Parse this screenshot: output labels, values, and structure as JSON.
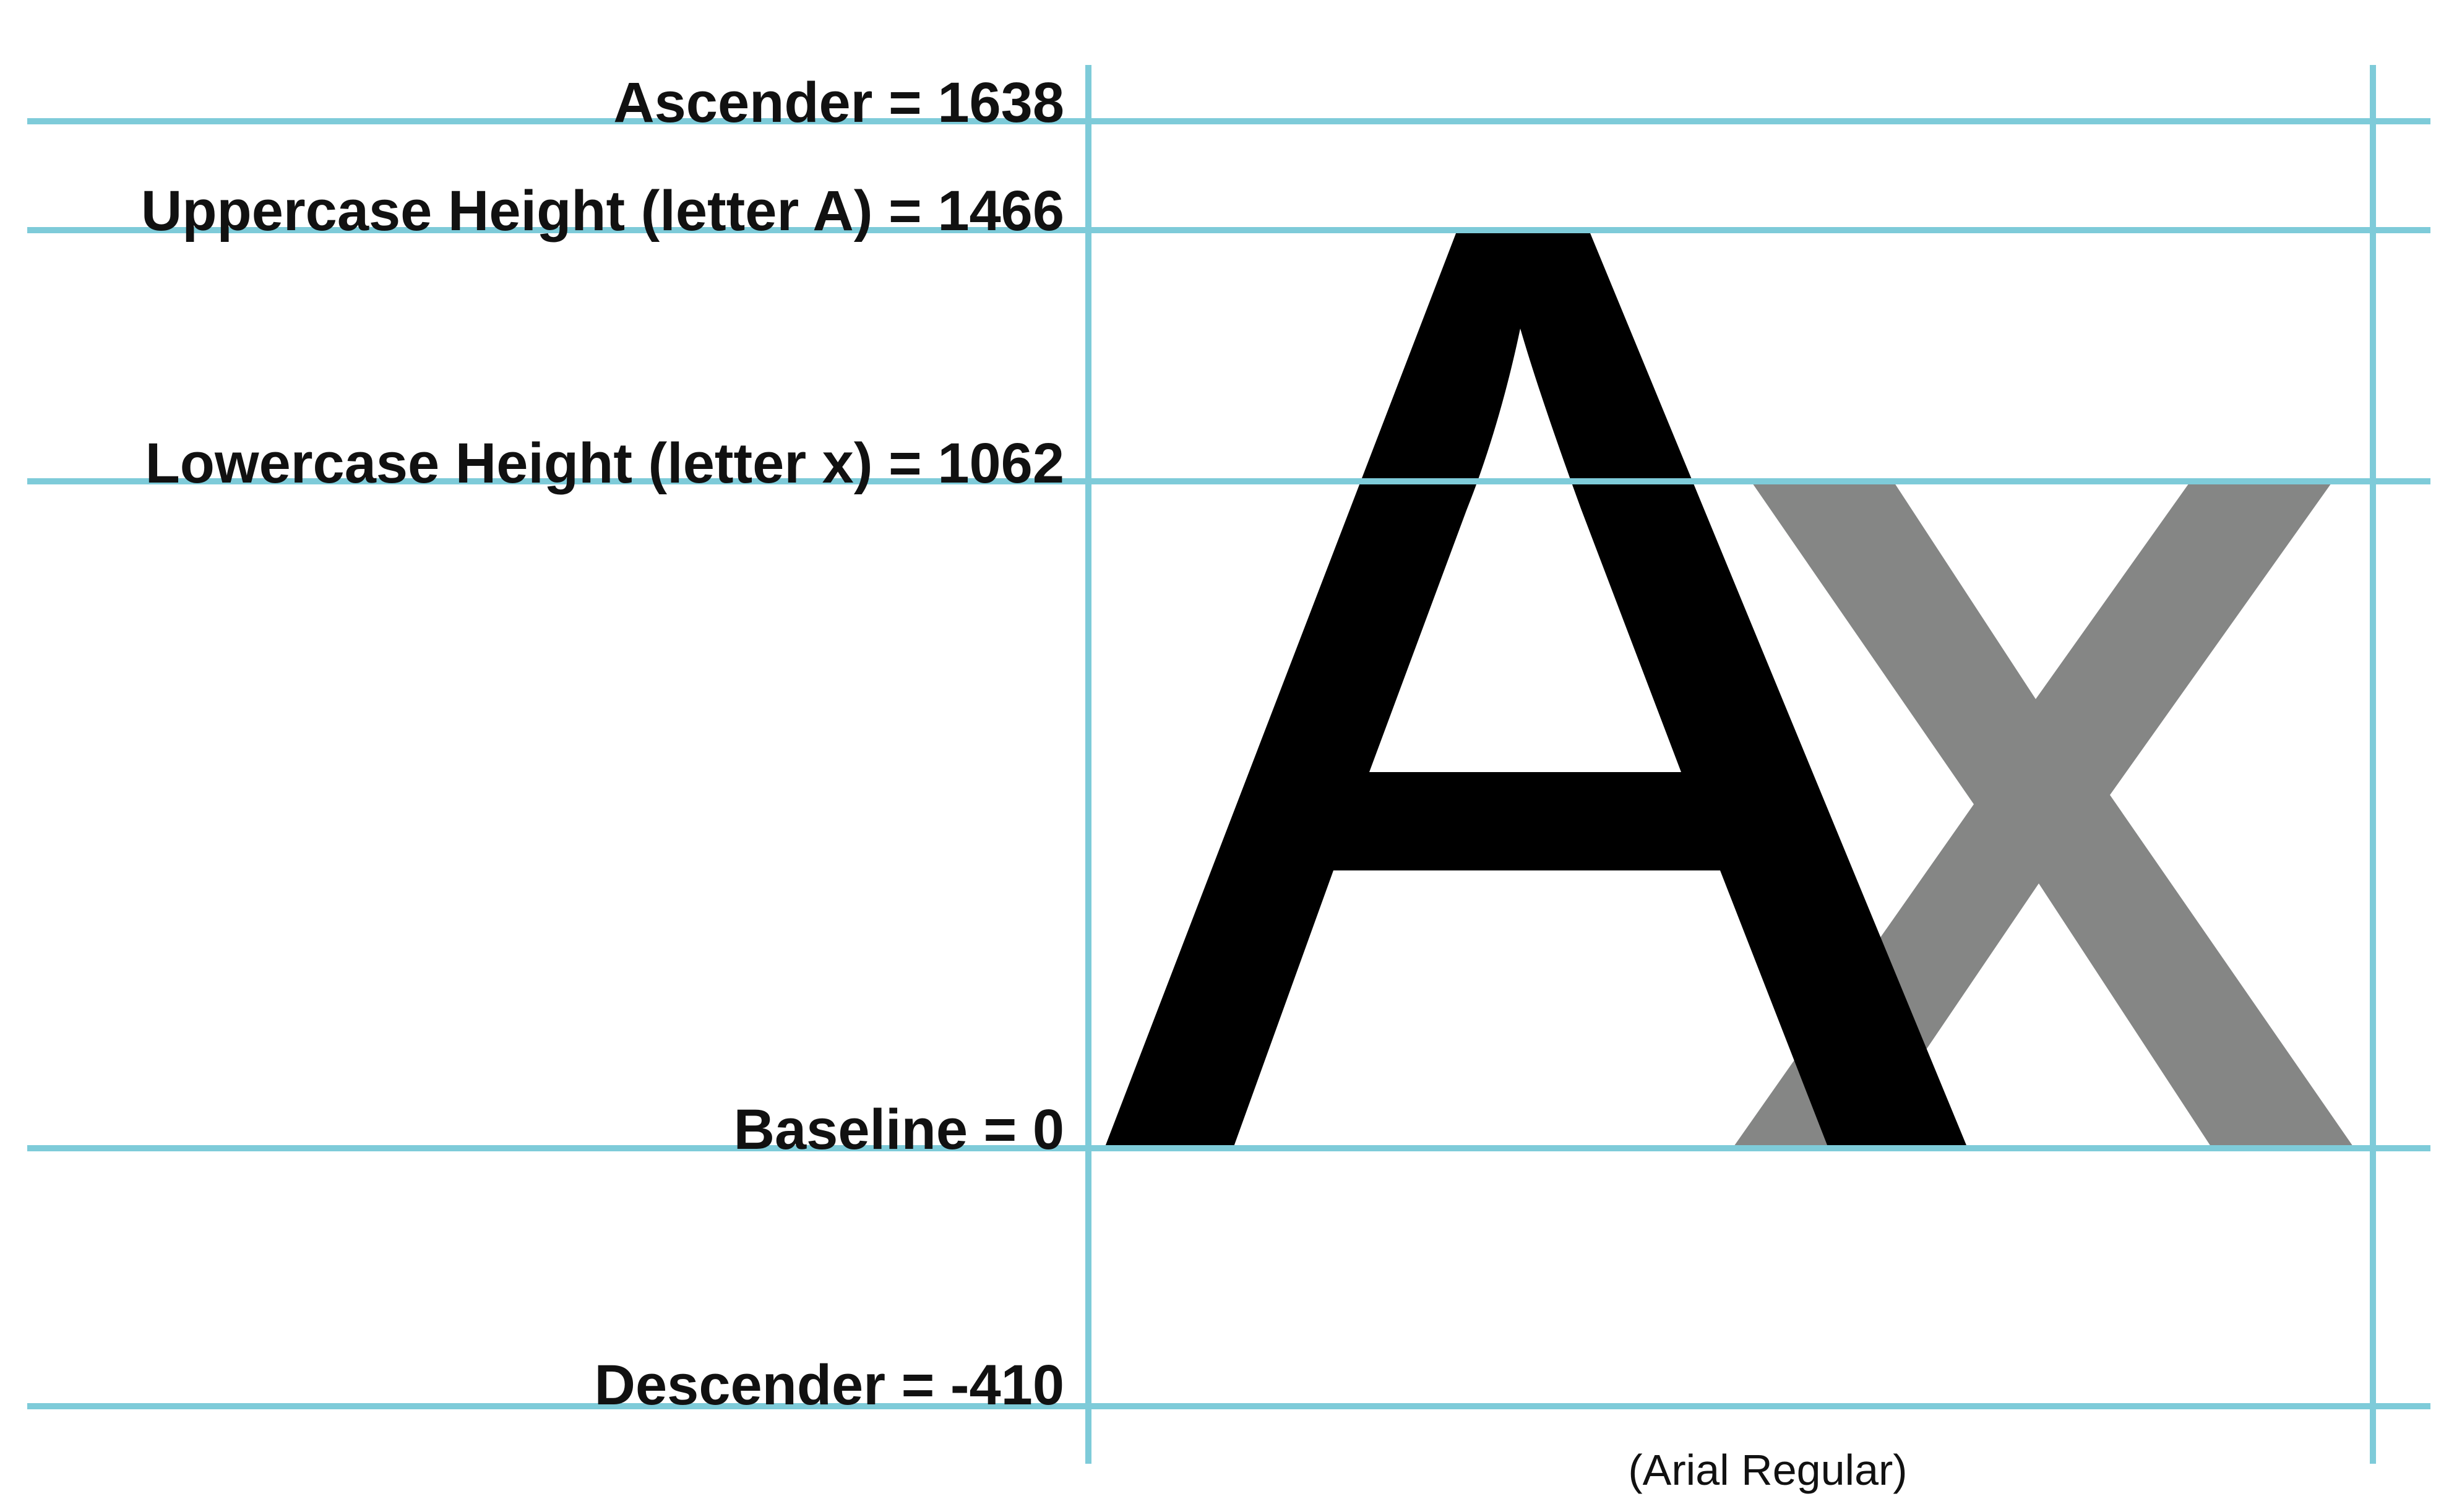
{
  "labels": {
    "ascender": "Ascender = 1638",
    "uppercase_height": "Uppercase Height (letter A) = 1466",
    "lowercase_height": "Lowercase Height (letter x) = 1062",
    "baseline": "Baseline = 0",
    "descender": "Descender = -410"
  },
  "caption": "(Arial Regular)",
  "metrics": {
    "ascender": 1638,
    "uppercase_height": 1466,
    "lowercase_height": 1062,
    "baseline": 0,
    "descender": -410
  },
  "glyphs": {
    "uppercase": "A",
    "lowercase": "x"
  },
  "colors": {
    "guide_line": "#7ecbd9",
    "uppercase_glyph": "#000000",
    "lowercase_glyph": "#858685",
    "label_text": "#111111",
    "background": "#ffffff"
  }
}
